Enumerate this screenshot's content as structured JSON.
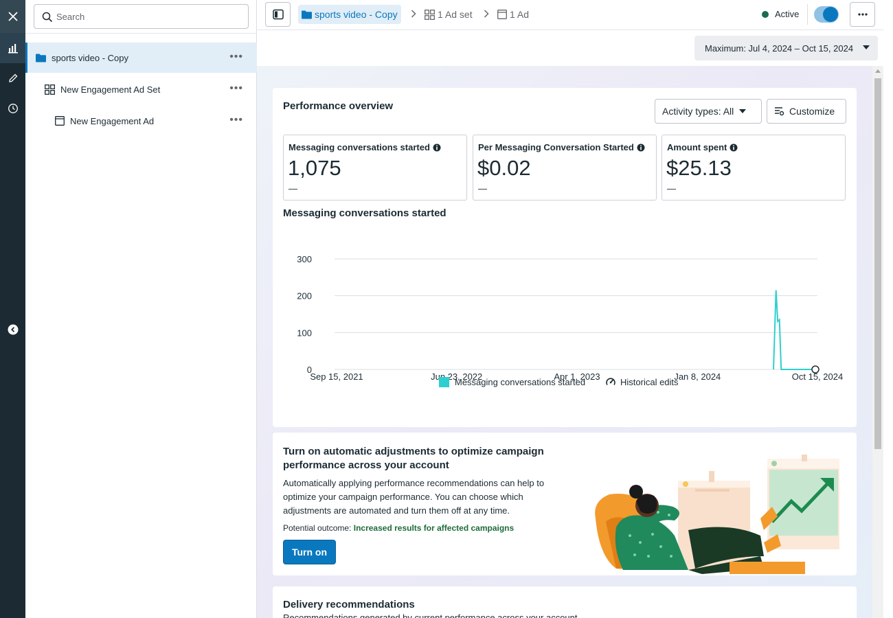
{
  "rail": {
    "close_icon": "close-icon",
    "chart_icon": "bar-chart-icon",
    "edit_icon": "pencil-icon",
    "history_icon": "clock-icon",
    "collapse_icon": "chevron-left-icon"
  },
  "tree": {
    "search_placeholder": "Search",
    "items": [
      {
        "label": "sports video - Copy",
        "icon": "folder-icon"
      },
      {
        "label": "New Engagement Ad Set",
        "icon": "grid-icon"
      },
      {
        "label": "New Engagement Ad",
        "icon": "ad-icon"
      }
    ]
  },
  "header": {
    "breadcrumbs": [
      {
        "label": "sports video - Copy",
        "icon": "folder-icon"
      },
      {
        "label": "1 Ad set",
        "icon": "grid-icon"
      },
      {
        "label": "1 Ad",
        "icon": "ad-icon"
      }
    ],
    "status": "Active",
    "status_color": "#1d6b4f",
    "toggle_on": true
  },
  "date_range": {
    "label": "Maximum: Jul 4, 2024 – Oct 15, 2024"
  },
  "performance": {
    "title": "Performance overview",
    "activity_label": "Activity types: All",
    "customize_label": "Customize",
    "metrics": [
      {
        "label": "Messaging conversations started",
        "value": "1,075",
        "delta": "—"
      },
      {
        "label": "Per Messaging Conversation Started",
        "value": "$0.02",
        "delta": "—"
      },
      {
        "label": "Amount spent",
        "value": "$25.13",
        "delta": "—"
      }
    ]
  },
  "chart_data": {
    "type": "line",
    "title": "Messaging conversations started",
    "xlabel": "",
    "ylabel": "",
    "x_ticks": [
      "Sep 15, 2021",
      "Jun 23, 2022",
      "Apr 1, 2023",
      "Jan 8, 2024",
      "Oct 15, 2024"
    ],
    "y_ticks": [
      0,
      100,
      200,
      300
    ],
    "ylim": [
      0,
      300
    ],
    "grid": true,
    "series": [
      {
        "name": "Messaging conversations started",
        "color": "#2fcfcf",
        "points": [
          {
            "x": "Jul 4, 2024",
            "y": 0
          },
          {
            "x": "Jul 10, 2024",
            "y": 215
          },
          {
            "x": "Jul 14, 2024",
            "y": 130
          },
          {
            "x": "Jul 18, 2024",
            "y": 135
          },
          {
            "x": "Jul 22, 2024",
            "y": 0
          },
          {
            "x": "Oct 15, 2024",
            "y": 0
          }
        ]
      }
    ],
    "legend": [
      "Messaging conversations started",
      "Historical edits"
    ],
    "legend_position": "bottom"
  },
  "automatic": {
    "title": "Turn on automatic adjustments to optimize campaign performance across your account",
    "body": "Automatically applying performance recommendations can help to optimize your campaign performance. You can choose which adjustments are automated and turn them off at any time.",
    "outcome_prefix": "Potential outcome:",
    "outcome_value": "Increased results for affected campaigns",
    "button": "Turn on"
  },
  "delivery": {
    "title": "Delivery recommendations",
    "subtitle": "Recommendations generated by current performance across your account"
  }
}
